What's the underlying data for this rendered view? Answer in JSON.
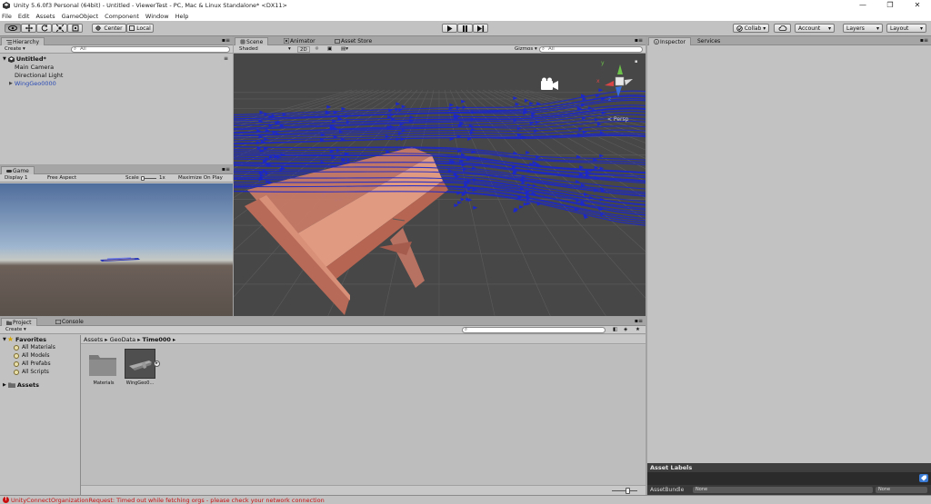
{
  "window": {
    "title": "Unity 5.6.0f3 Personal (64bit) - Untitled - ViewerTest - PC, Mac & Linux Standalone* <DX11>",
    "minimize": "—",
    "restore": "❐",
    "close": "✕"
  },
  "menu": [
    "File",
    "Edit",
    "Assets",
    "GameObject",
    "Component",
    "Window",
    "Help"
  ],
  "toolbar": {
    "pivot": "Center",
    "space": "Local",
    "collab": "Collab ▾",
    "account": "Account",
    "layers": "Layers",
    "layout": "Layout"
  },
  "hierarchy": {
    "tab": "Hierarchy",
    "create": "Create ▾",
    "search_placeholder": "All",
    "scene": "Untitled*",
    "items": [
      "Main Camera",
      "Directional Light",
      "WingGeo0000"
    ]
  },
  "scene_view": {
    "tabs": [
      "Scene",
      "Animator",
      "Asset Store"
    ],
    "shading": "Shaded",
    "mode_2d": "2D",
    "gizmos": "Gizmos ▾",
    "search_placeholder": "All",
    "projection": "< Persp",
    "axis_x": "x",
    "axis_y": "y",
    "axis_z": "z"
  },
  "game_view": {
    "tab": "Game",
    "display": "Display 1",
    "aspect": "Free Aspect",
    "scale_label": "Scale",
    "scale_value": "1x",
    "maximize": "Maximize On Play"
  },
  "project": {
    "tabs": [
      "Project",
      "Console"
    ],
    "create": "Create ▾",
    "favorites_label": "Favorites",
    "favorites": [
      "All Materials",
      "All Models",
      "All Prefabs",
      "All Scripts"
    ],
    "assets_label": "Assets",
    "breadcrumb": [
      "Assets",
      "GeoData",
      "Time000"
    ],
    "items": [
      {
        "label": "Materials",
        "kind": "folder"
      },
      {
        "label": "WingGeo0...",
        "kind": "model"
      }
    ]
  },
  "inspector": {
    "tabs": [
      "Inspector",
      "Services"
    ],
    "asset_labels": "Asset Labels",
    "asset_bundle": "AssetBundle",
    "bundle_value": "None",
    "variant_value": "None"
  },
  "status": {
    "message": "UnityConnectOrganizationRequest: Timed out while fetching orgs - please check your network connection",
    "color": "#c81010"
  },
  "colors": {
    "streamline": "#1c28c8",
    "wing": "#d9907a",
    "scene_bg": "#4a4a4a"
  }
}
